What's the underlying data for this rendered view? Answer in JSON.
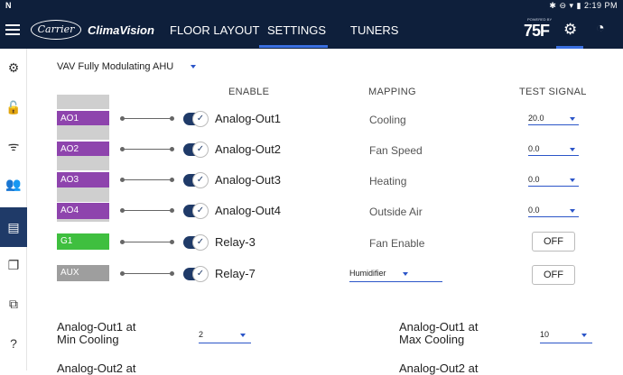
{
  "status_bar": {
    "left_icon": "N",
    "time": "2:19 PM",
    "icons": "bluetooth wifi battery"
  },
  "app_bar": {
    "logo_text": "Carrier",
    "brand": "ClimaVision",
    "tabs": [
      {
        "label": "FLOOR LAYOUT",
        "active": false
      },
      {
        "label": "SETTINGS",
        "active": true
      },
      {
        "label": "TUNERS",
        "active": false
      }
    ],
    "powered_by": "POWERED BY",
    "partner_logo": "75F"
  },
  "sidebar": {
    "items": [
      {
        "name": "settings-gear-icon",
        "glyph": "⚙"
      },
      {
        "name": "lock-icon",
        "glyph": "🔓"
      },
      {
        "name": "wifi-icon",
        "glyph": "ᯤ"
      },
      {
        "name": "user-settings-icon",
        "glyph": "👥"
      },
      {
        "name": "modules-icon",
        "glyph": "▤",
        "active": true
      },
      {
        "name": "copy-icon",
        "glyph": "❐"
      },
      {
        "name": "network-icon",
        "glyph": "⧉"
      },
      {
        "name": "help-icon",
        "glyph": "?"
      }
    ]
  },
  "profile_dropdown": {
    "value": "VAV Fully Modulating AHU"
  },
  "columns": {
    "enable": "ENABLE",
    "mapping": "MAPPING",
    "test_signal": "TEST SIGNAL"
  },
  "rows": [
    {
      "port": "AO1",
      "color": "#8e44ad",
      "name": "Analog-Out1",
      "enabled": true,
      "mapping": "Cooling",
      "test": "20.0"
    },
    {
      "port": "AO2",
      "color": "#8e44ad",
      "name": "Analog-Out2",
      "enabled": true,
      "mapping": "Fan Speed",
      "test": "0.0"
    },
    {
      "port": "AO3",
      "color": "#8e44ad",
      "name": "Analog-Out3",
      "enabled": true,
      "mapping": "Heating",
      "test": "0.0"
    },
    {
      "port": "AO4",
      "color": "#8e44ad",
      "name": "Analog-Out4",
      "enabled": true,
      "mapping": "Outside Air",
      "test": "0.0"
    },
    {
      "port": "G1",
      "color": "#3fbf3f",
      "name": "Relay-3",
      "enabled": true,
      "mapping": "Fan Enable",
      "test": "OFF"
    },
    {
      "port": "AUX",
      "color": "#9e9e9e",
      "name": "Relay-7",
      "enabled": true,
      "mapping": "Humidifier",
      "test": "OFF"
    }
  ],
  "min_max": [
    {
      "label_line1": "Analog-Out1 at",
      "label_line2": "Min Cooling",
      "value": "2"
    },
    {
      "label_line1": "Analog-Out1 at",
      "label_line2": "Max Cooling",
      "value": "10"
    },
    {
      "label_line1": "Analog-Out2 at",
      "label_line2": "",
      "value": ""
    },
    {
      "label_line1": "Analog-Out2 at",
      "label_line2": "",
      "value": ""
    }
  ]
}
